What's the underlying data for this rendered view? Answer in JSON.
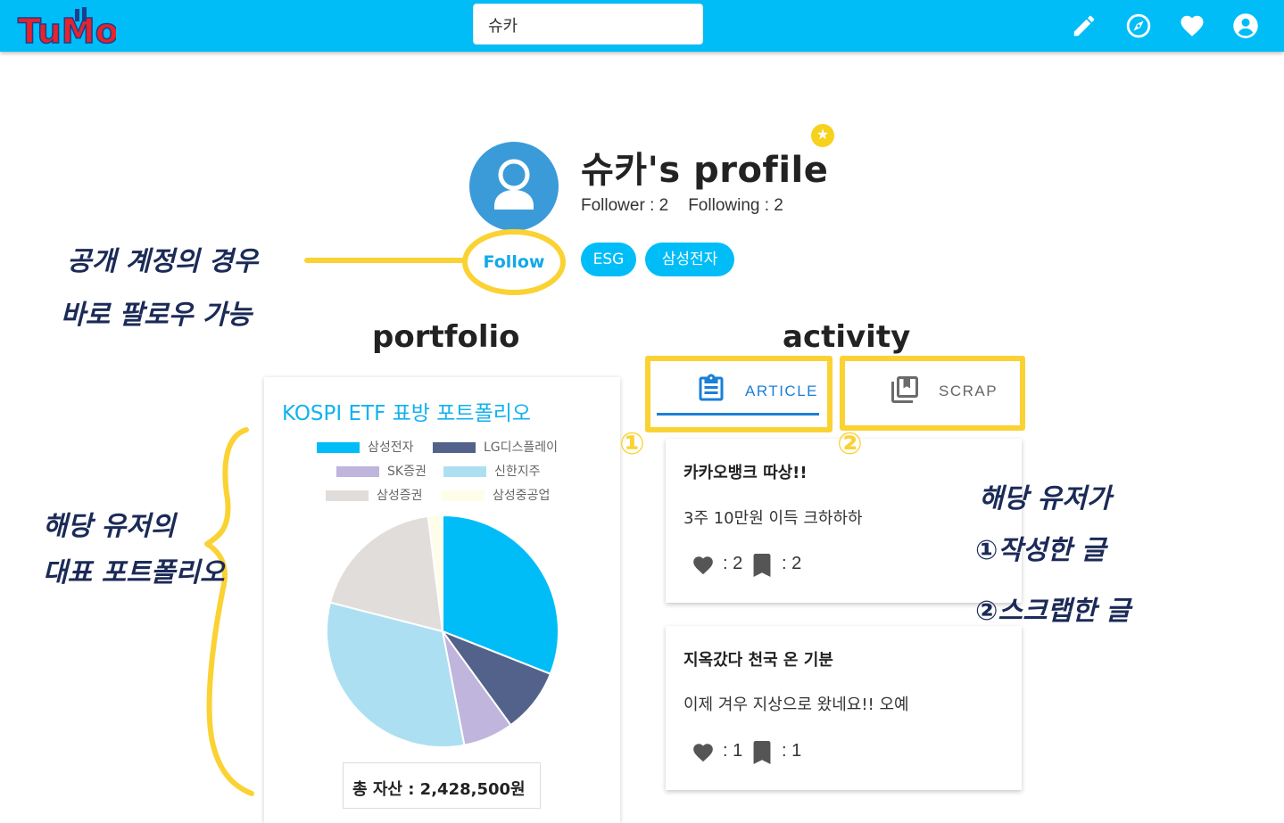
{
  "colors": {
    "topbar": "#00bdf7",
    "accent": "#00bdf7",
    "annotation_yellow": "#fbd233",
    "annotation_ink": "#1b2a57"
  },
  "header": {
    "logo_text": "TuMo",
    "search_value": "슈카",
    "icons": [
      "pencil-icon",
      "compass-icon",
      "heart-icon",
      "account-icon"
    ]
  },
  "profile": {
    "title": "슈카's profile",
    "follower": "Follower : 2",
    "following": "Following : 2",
    "follow_label": "Follow",
    "tags": [
      "ESG",
      "삼성전자"
    ]
  },
  "sections": {
    "portfolio": "portfolio",
    "activity": "activity"
  },
  "portfolio": {
    "title": "KOSPI ETF 표방 포트폴리오",
    "total": "총 자산 : 2,428,500원"
  },
  "chart_data": {
    "type": "pie",
    "title": "",
    "legend": [
      "삼성전자",
      "LG디스플레이",
      "SK증권",
      "신한지주",
      "삼성증권",
      "삼성중공업"
    ],
    "categories": [
      "삼성전자",
      "LG디스플레이",
      "SK증권",
      "신한지주",
      "삼성증권",
      "삼성중공업"
    ],
    "values": [
      31,
      9,
      7,
      32,
      19,
      2
    ],
    "colors": [
      "#00bdf7",
      "#53628a",
      "#c0b5dc",
      "#addff2",
      "#e1ddda",
      "#fefde9"
    ]
  },
  "activity": {
    "tabs": [
      {
        "label": "ARTICLE",
        "active": true
      },
      {
        "label": "SCRAP",
        "active": false
      }
    ],
    "posts": [
      {
        "title": "카카오뱅크 따상!!",
        "body": "3주 10만원 이득 크하하하",
        "likes": ": 2",
        "scraps": ": 2"
      },
      {
        "title": "지옥갔다 천국 온 기분",
        "body": "이제 겨우 지상으로 왔네요!! 오예",
        "likes": ": 1",
        "scraps": ": 1"
      }
    ]
  },
  "annotations": {
    "follow_note_1": "공개 계정의 경우",
    "follow_note_2": "바로 팔로우 가능",
    "portfolio_note_1": "해당 유저의",
    "portfolio_note_2": "대표 포트폴리오",
    "activity_note_1": "해당 유저가",
    "activity_note_2": "①작성한 글",
    "activity_note_3": "②스크랩한 글",
    "marker_1": "①",
    "marker_2": "②"
  }
}
